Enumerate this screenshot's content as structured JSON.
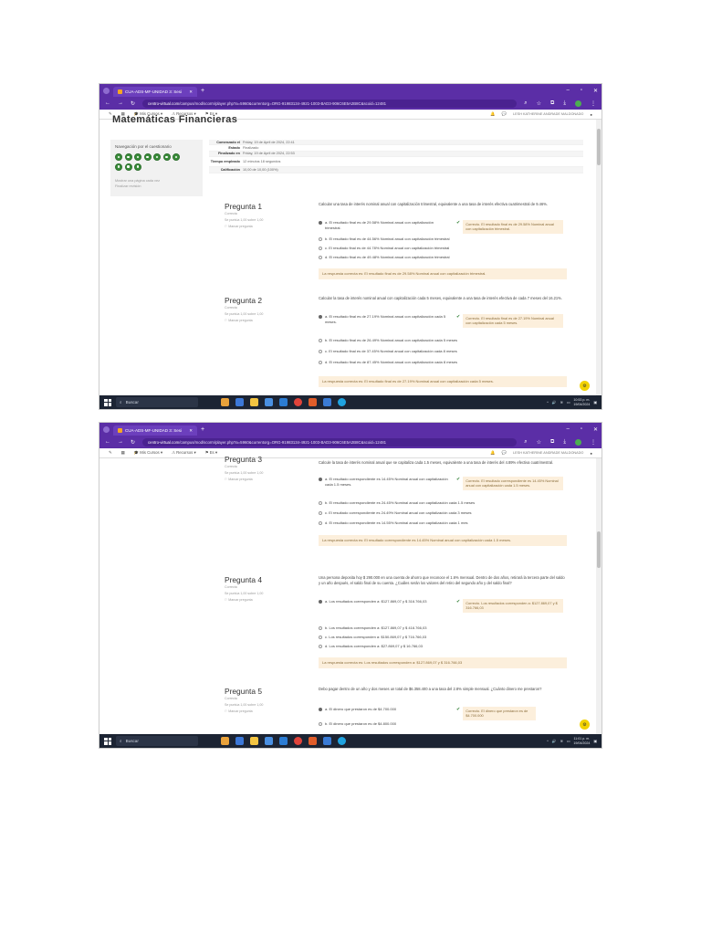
{
  "browser": {
    "tab_title": "CUA-ADS-MF-UNIDAD 3: Sesi",
    "url_host": "centro-virtual.com",
    "url_path": "/campus/mod/scorm/player.php?a=5960&currentorg=ORG-91983134-4921-1003-BAD3-906C6E5A2B8C&scoid=12481"
  },
  "moodle": {
    "menu_courses": "Mis Cursos",
    "menu_resources": "Recursos",
    "menu_es": "Es",
    "user": "LESH KATHERINE ANDRADE MALDONADO"
  },
  "page": {
    "heading_fragment": "Matemáticas Financieras",
    "nav_title": "Navegación por el cuestionario",
    "nav_link1": "Mostrar una página cada vez",
    "nav_link2": "Finalizar revisión",
    "summary": [
      {
        "k": "Comenzado el",
        "v": "Friday, 19 de April de 2024, 22:41"
      },
      {
        "k": "Estado",
        "v": "Finalizado"
      },
      {
        "k": "Finalizado en",
        "v": "Friday, 19 de April de 2024, 22:53"
      },
      {
        "k": "Tiempo empleado",
        "v": "12 minutos 18 segundos"
      },
      {
        "k": "Calificación",
        "v": "10,00 de 10,00 (100%)"
      }
    ]
  },
  "shot1": {
    "q1": {
      "title": "Pregunta 1",
      "status": "Correcta",
      "score": "Se puntúa 1,00 sobre 1,00",
      "flag": "Marcar pregunta",
      "text": "Calcular una tasa de interés nominal anual con capitalización trimestral, equivalente a una tasa de interés efectiva cuatrimestral de 9.46%.",
      "answers": [
        "a. El resultado final es de 29.58% Nominal anual con capitalización trimestral.",
        "b. El resultado final es de 44.56% Nominal anual con capitalización trimestral",
        "c. El resultado final es de 44.78% Nominal anual con capitalización trimestral",
        "d. El resultado final es de 49.48% Nominal anual con capitalización trimestral"
      ],
      "feedback": "Correcto. El resultado final es de 29.58% Nominal anual con capitalización trimestral.",
      "right": "La respuesta correcta es: El resultado final es de 29.58% Nominal anual con capitalización trimestral."
    },
    "q2": {
      "title": "Pregunta 2",
      "status": "Correcta",
      "score": "Se puntúa 1,00 sobre 1,00",
      "flag": "Marcar pregunta",
      "text": "Calcular la tasa de interés nominal anual con capitalización cada 5 meses, equivalente a una tasa de interés efectiva de cada 7 meses del 16.21%.",
      "answers": [
        "a. El resultado final es de 27.19% Nominal anual con capitalización cada 5 meses.",
        "b. El resultado final es de 26.49% Nominal anual con capitalización cada 5 meses",
        "c. El resultado final es de 37.45% Nominal anual con capitalización cada 8 meses",
        "d. El resultado final es de 87.45% Nominal anual con capitalización cada 8 meses"
      ],
      "feedback": "Correcto. El resultado final es de 27.19% Nominal anual con capitalización cada 5 meses.",
      "right": "La respuesta correcta es: El resultado final es de 27.19% Nominal anual con capitalización cada 5 meses."
    }
  },
  "shot2": {
    "q3": {
      "title": "Pregunta 3",
      "status": "Correcta",
      "score": "Se puntúa 1,00 sobre 1,00",
      "flag": "Marcar pregunta",
      "text": "Calcule la tasa de interés nominal anual que se capitaliza cada 1.5 meses, equivalente a una tasa de interés del 4.89% efectiva cuatrimestral.",
      "answers": [
        "a. El resultado correspondiente es 14.45% Nominal anual con capitalización cada 1.5 meses.",
        "b. El resultado correspondiente es 24.45% Nominal anual con capitalización cada 1.5 meses",
        "c. El resultado correspondiente es 24.49% Nominal anual con capitalización cada 3 meses",
        "d. El resultado correspondiente es 14.55% Nominal anual con capitalización cada 1 mes"
      ],
      "feedback": "Correcto. El resultado correspondiente es 14.45% Nominal anual con capitalización cada 1.5 meses.",
      "right": "La respuesta correcta es: El resultado correspondiente es 14.45% Nominal anual con capitalización cada 1.5 meses."
    },
    "q4": {
      "title": "Pregunta 4",
      "status": "Correcta",
      "score": "Se puntúa 1,00 sobre 1,00",
      "flag": "Marcar pregunta",
      "text": "Una persona deposita hoy $ 290.000 en una cuenta de ahorro que reconoce el 1.6% mensual. Dentro de dos años, retirará la tercera parte del saldo y un año después, el saldo final de su cuenta. ¿Cuáles serán los valores del retiro del segundo año y del saldo final?",
      "answers": [
        "a. Los resultados corresponden a: $127.869,07 y $ 316.766,03",
        "b. Los resultados corresponden a: $127.869,07 y $ 416.766,03",
        "c. Los resultados corresponden a: $150.869,07 y $ 716.766,03",
        "d. Los resultados corresponden a: $27.869,07 y $ 16.766,03"
      ],
      "feedback": "Correcto. Los resultados corresponden a: $127.869,07 y $ 316.766,03",
      "right": "La respuesta correcta es: Los resultados corresponden a: $127.869,07 y $ 316.766,03"
    },
    "q5": {
      "title": "Pregunta 5",
      "status": "Correcta",
      "score": "Se puntúa 1,00 sobre 1,00",
      "flag": "Marcar pregunta",
      "text": "Debo pagar dentro de un año y dos meses un total de $6.358.400 a una tasa del 2.8% simple mensual. ¿Cuánto dinero me prestaron?",
      "answers": [
        "a. El dinero que prestaron es de $4.700.000",
        "b. El dinero que prestaron es de $4.800.000"
      ],
      "feedback": "Correcto. El dinero que prestaron es de $4.700.000"
    }
  },
  "taskbar": {
    "search": "Buscar",
    "time1": "10:53 p. m.",
    "date1": "19/04/2024",
    "time2": "11:01 p. m.",
    "date2": "19/04/2024"
  },
  "colors": {
    "browser": "#5b2ea6",
    "correct_feedback": "#fcefdc",
    "bubble": "#3a8d3a"
  }
}
